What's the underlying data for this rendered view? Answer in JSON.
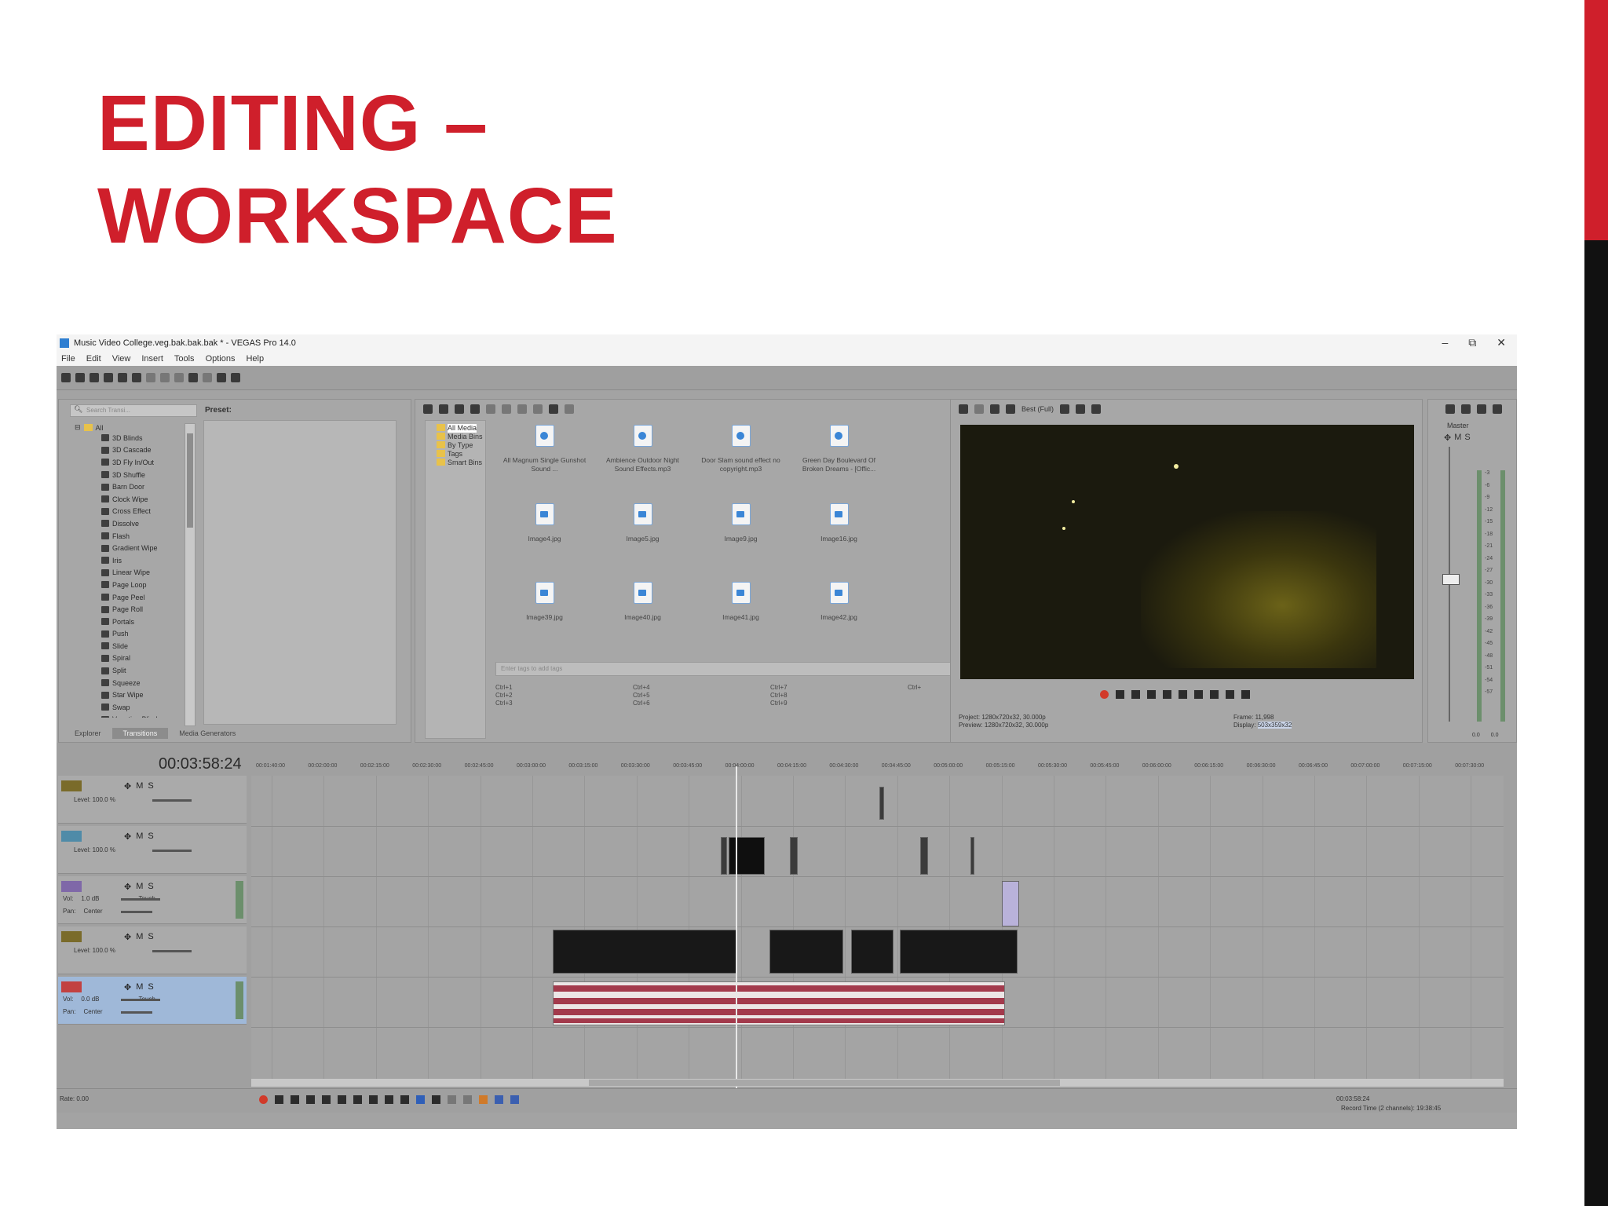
{
  "slide": {
    "title_line1": "EDITING –",
    "title_line2": "WORKSPACE",
    "accent_color": "#cf1f2b"
  },
  "window": {
    "title": "Music Video College.veg.bak.bak.bak * - VEGAS Pro 14.0",
    "menu": [
      "File",
      "Edit",
      "View",
      "Insert",
      "Tools",
      "Options",
      "Help"
    ],
    "controls": [
      "–",
      "⧉",
      "✕"
    ]
  },
  "transitions": {
    "search_placeholder": "Search Transi...",
    "preset_label": "Preset:",
    "root_label": "All",
    "items": [
      "3D Blinds",
      "3D Cascade",
      "3D Fly In/Out",
      "3D Shuffle",
      "Barn Door",
      "Clock Wipe",
      "Cross Effect",
      "Dissolve",
      "Flash",
      "Gradient Wipe",
      "Iris",
      "Linear Wipe",
      "Page Loop",
      "Page Peel",
      "Page Roll",
      "Portals",
      "Push",
      "Slide",
      "Spiral",
      "Split",
      "Squeeze",
      "Star Wipe",
      "Swap",
      "Venetian Blinds"
    ],
    "tabs": [
      "Explorer",
      "Transitions",
      "Media Generators"
    ],
    "active_tab": "Transitions"
  },
  "media": {
    "bins": [
      "All Media",
      "Media Bins",
      "By Type",
      "Tags",
      "Smart Bins"
    ],
    "files": [
      {
        "name": "All Magnum Single Gunshot Sound ...",
        "kind": "audio"
      },
      {
        "name": "Ambience Outdoor Night Sound Effects.mp3",
        "kind": "audio"
      },
      {
        "name": "Door Slam sound effect no copyright.mp3",
        "kind": "audio"
      },
      {
        "name": "Green Day Boulevard Of Broken Dreams - [Offic...",
        "kind": "audio"
      },
      {
        "name": "Image4.jpg",
        "kind": "image"
      },
      {
        "name": "Image5.jpg",
        "kind": "image"
      },
      {
        "name": "Image9.jpg",
        "kind": "image"
      },
      {
        "name": "Image16.jpg",
        "kind": "image"
      },
      {
        "name": "Image39.jpg",
        "kind": "image"
      },
      {
        "name": "Image40.jpg",
        "kind": "image"
      },
      {
        "name": "Image41.jpg",
        "kind": "image"
      },
      {
        "name": "Image42.jpg",
        "kind": "image"
      }
    ],
    "tag_placeholder": "Enter tags to add tags",
    "shortcuts": [
      "Ctrl+1",
      "Ctrl+4",
      "Ctrl+7",
      "Ctrl+",
      "Ctrl+2",
      "Ctrl+5",
      "Ctrl+8",
      "",
      "Ctrl+3",
      "Ctrl+6",
      "Ctrl+9",
      ""
    ]
  },
  "preview": {
    "quality": "Best (Full)",
    "project": "Project:  1280x720x32, 30.000p",
    "preview": "Preview:  1280x720x32, 30.000p",
    "frame_label": "Frame:",
    "frame_value": "11,998",
    "display_label": "Display:",
    "display_value": "503x359x32"
  },
  "master": {
    "label": "Master",
    "scale": [
      "-3",
      "-6",
      "-9",
      "-12",
      "-15",
      "-18",
      "-21",
      "-24",
      "-27",
      "-30",
      "-33",
      "-36",
      "-39",
      "-42",
      "-45",
      "-48",
      "-51",
      "-54",
      "-57"
    ],
    "bottom_values": [
      "0.0",
      "0.0"
    ]
  },
  "timeline": {
    "timecode": "00:03:58:24",
    "ruler": [
      "00:01:40:00",
      "00:02:00:00",
      "00:02:15:00",
      "00:02:30:00",
      "00:02:45:00",
      "00:03:00:00",
      "00:03:15:00",
      "00:03:30:00",
      "00:03:45:00",
      "00:04:00:00",
      "00:04:15:00",
      "00:04:30:00",
      "00:04:45:00",
      "00:05:00:00",
      "00:05:15:00",
      "00:05:30:00",
      "00:05:45:00",
      "00:06:00:00",
      "00:06:15:00",
      "00:06:30:00",
      "00:06:45:00",
      "00:07:00:00",
      "00:07:15:00",
      "00:07:30:00"
    ],
    "tracks": [
      {
        "type": "video",
        "level": "Level: 100.0 %"
      },
      {
        "type": "video",
        "level": "Level: 100.0 %"
      },
      {
        "type": "audio",
        "vol_label": "Vol:",
        "vol": "1.0 dB",
        "pan_label": "Pan:",
        "pan": "Center",
        "mode": "Touch"
      },
      {
        "type": "video",
        "level": "Level: 100.0 %"
      },
      {
        "type": "audio",
        "vol_label": "Vol:",
        "vol": "0.0 dB",
        "pan_label": "Pan:",
        "pan": "Center",
        "mode": "Touch"
      }
    ],
    "mute": "M",
    "solo": "S",
    "rate": "Rate: 0.00",
    "cursor_time": "00:03:58:24",
    "record_time": "Record Time (2 channels): 19:38:45"
  }
}
